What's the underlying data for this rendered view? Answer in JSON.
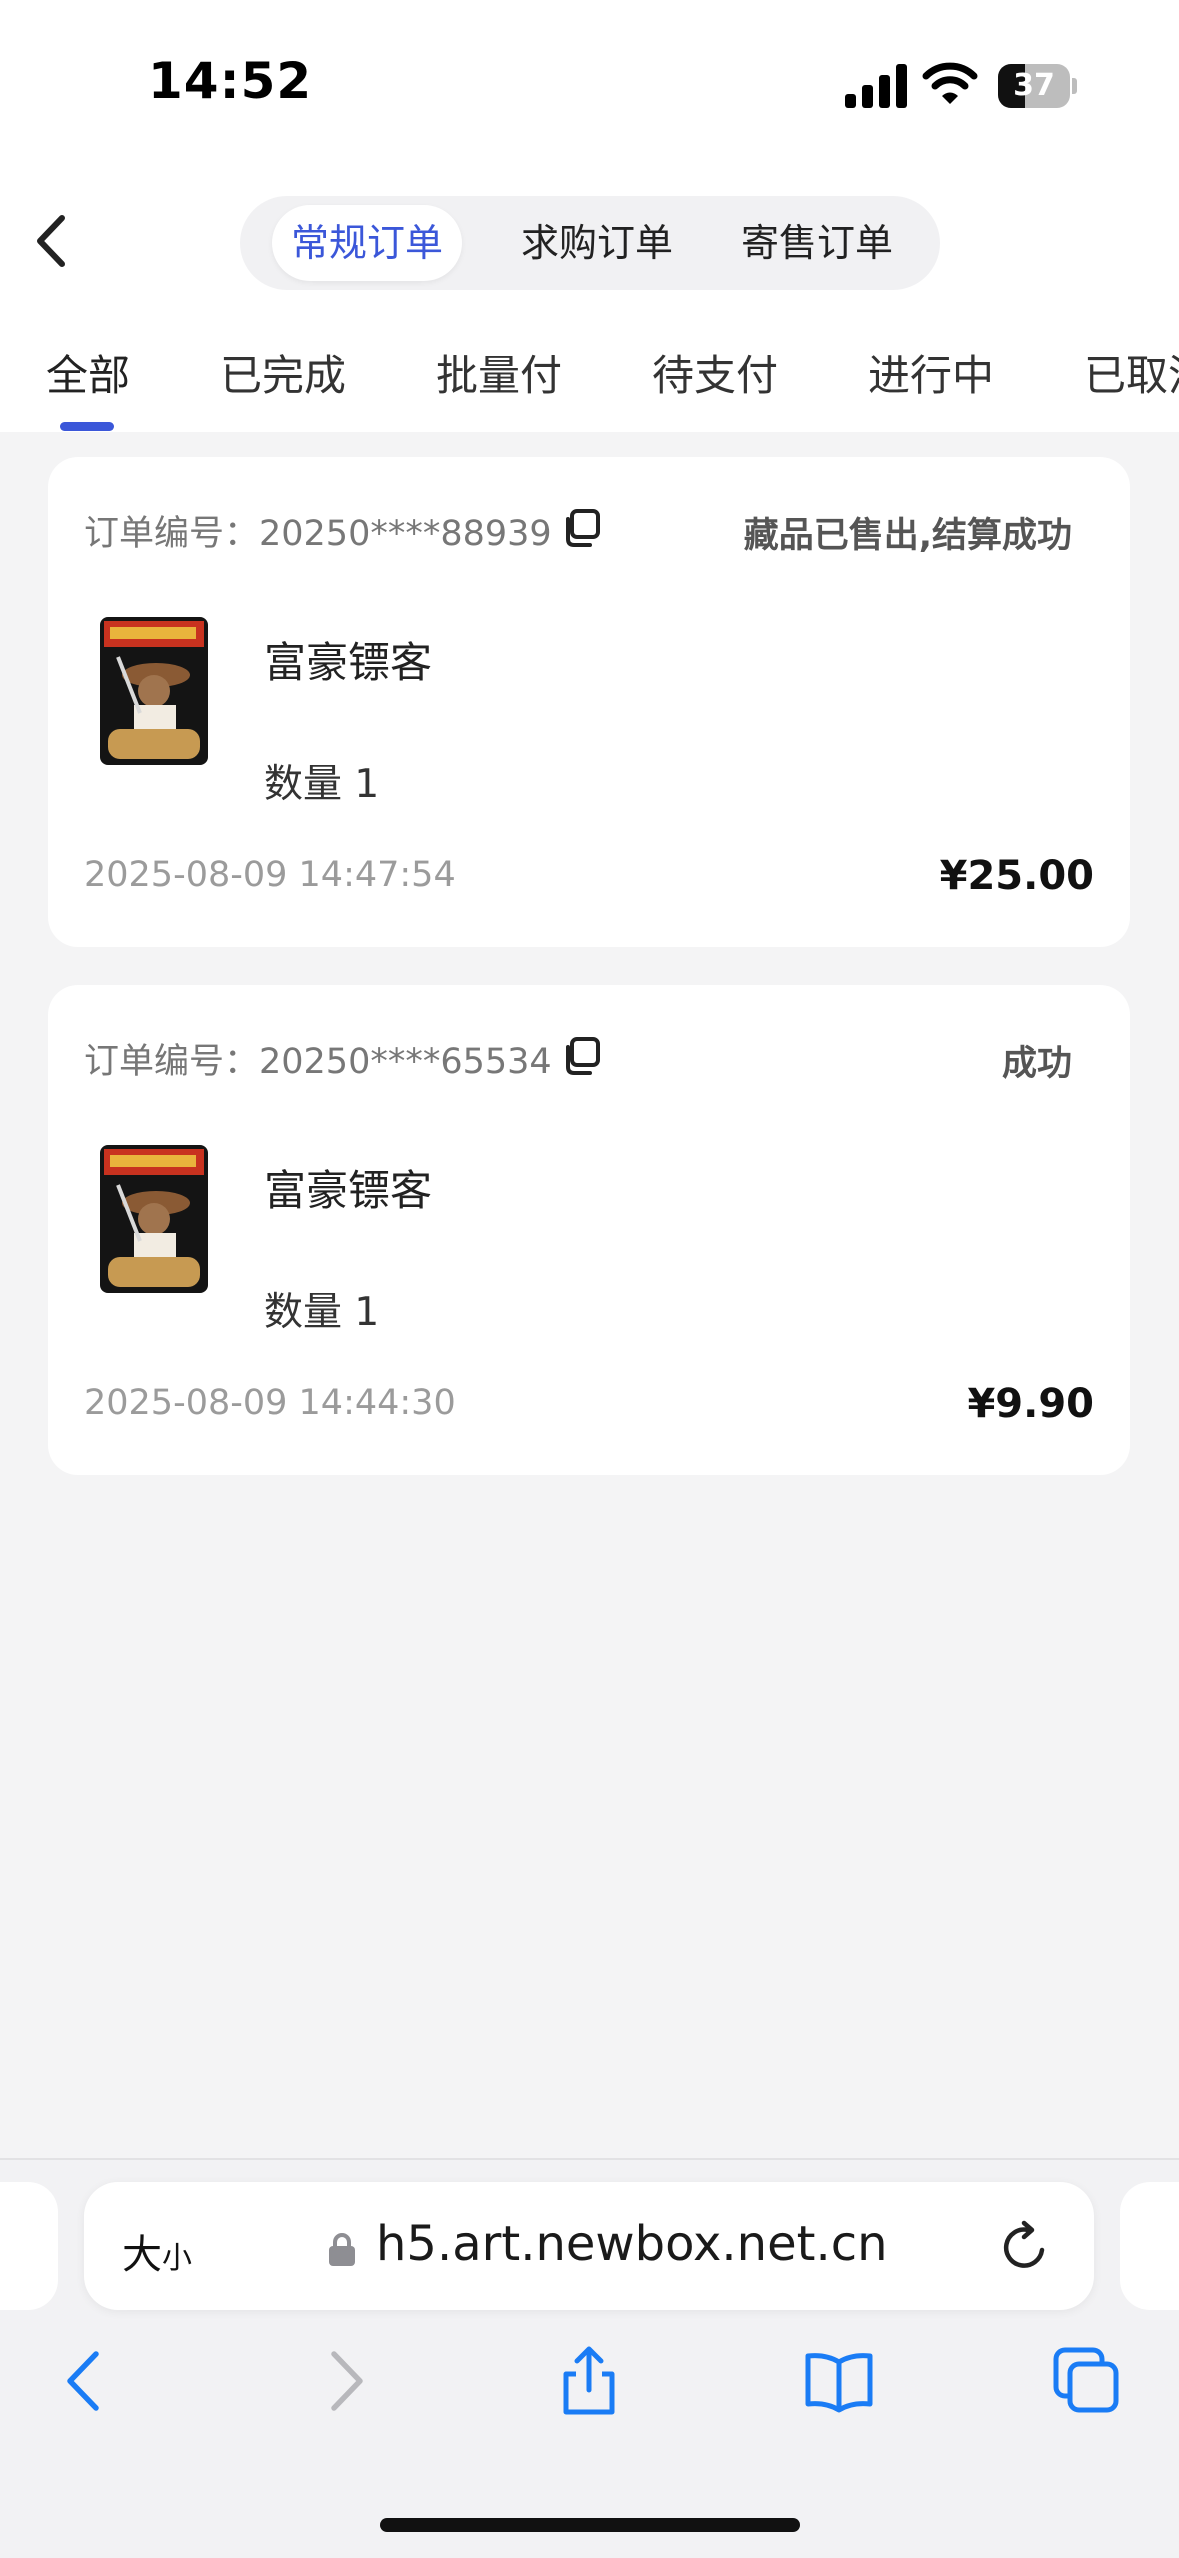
{
  "status_bar": {
    "time": "14:52",
    "battery": "37",
    "battery_level": 0.37
  },
  "header": {
    "back_icon": "chevron-left-icon",
    "segments": [
      {
        "label": "常规订单",
        "active": true
      },
      {
        "label": "求购订单",
        "active": false
      },
      {
        "label": "寄售订单",
        "active": false
      }
    ]
  },
  "tabs": [
    {
      "label": "全部",
      "active": true
    },
    {
      "label": "已完成",
      "active": false
    },
    {
      "label": "批量付",
      "active": false
    },
    {
      "label": "待支付",
      "active": false
    },
    {
      "label": "进行中",
      "active": false
    },
    {
      "label": "已取消",
      "active": false
    }
  ],
  "orders": [
    {
      "order_label": "订单编号：20250****88939",
      "status": "藏品已售出,结算成功",
      "item_name": "富豪镖客",
      "quantity": "数量 1",
      "time": "2025-08-09 14:47:54",
      "price": "¥25.00"
    },
    {
      "order_label": "订单编号：20250****65534",
      "status": "成功",
      "item_name": "富豪镖客",
      "quantity": "数量 1",
      "time": "2025-08-09 14:44:30",
      "price": "¥9.90"
    }
  ],
  "browser": {
    "text_size_big": "大",
    "text_size_small": "小",
    "url": "h5.art.newbox.net.cn",
    "icons": [
      "lock-icon",
      "reload-icon",
      "back-arrow-icon",
      "forward-arrow-icon",
      "share-icon",
      "bookmarks-icon",
      "tabs-icon"
    ]
  },
  "colors": {
    "accent": "#3b57d9",
    "background": "#f4f4f5",
    "card": "#ffffff",
    "ios_blue": "#1a7cf5"
  }
}
